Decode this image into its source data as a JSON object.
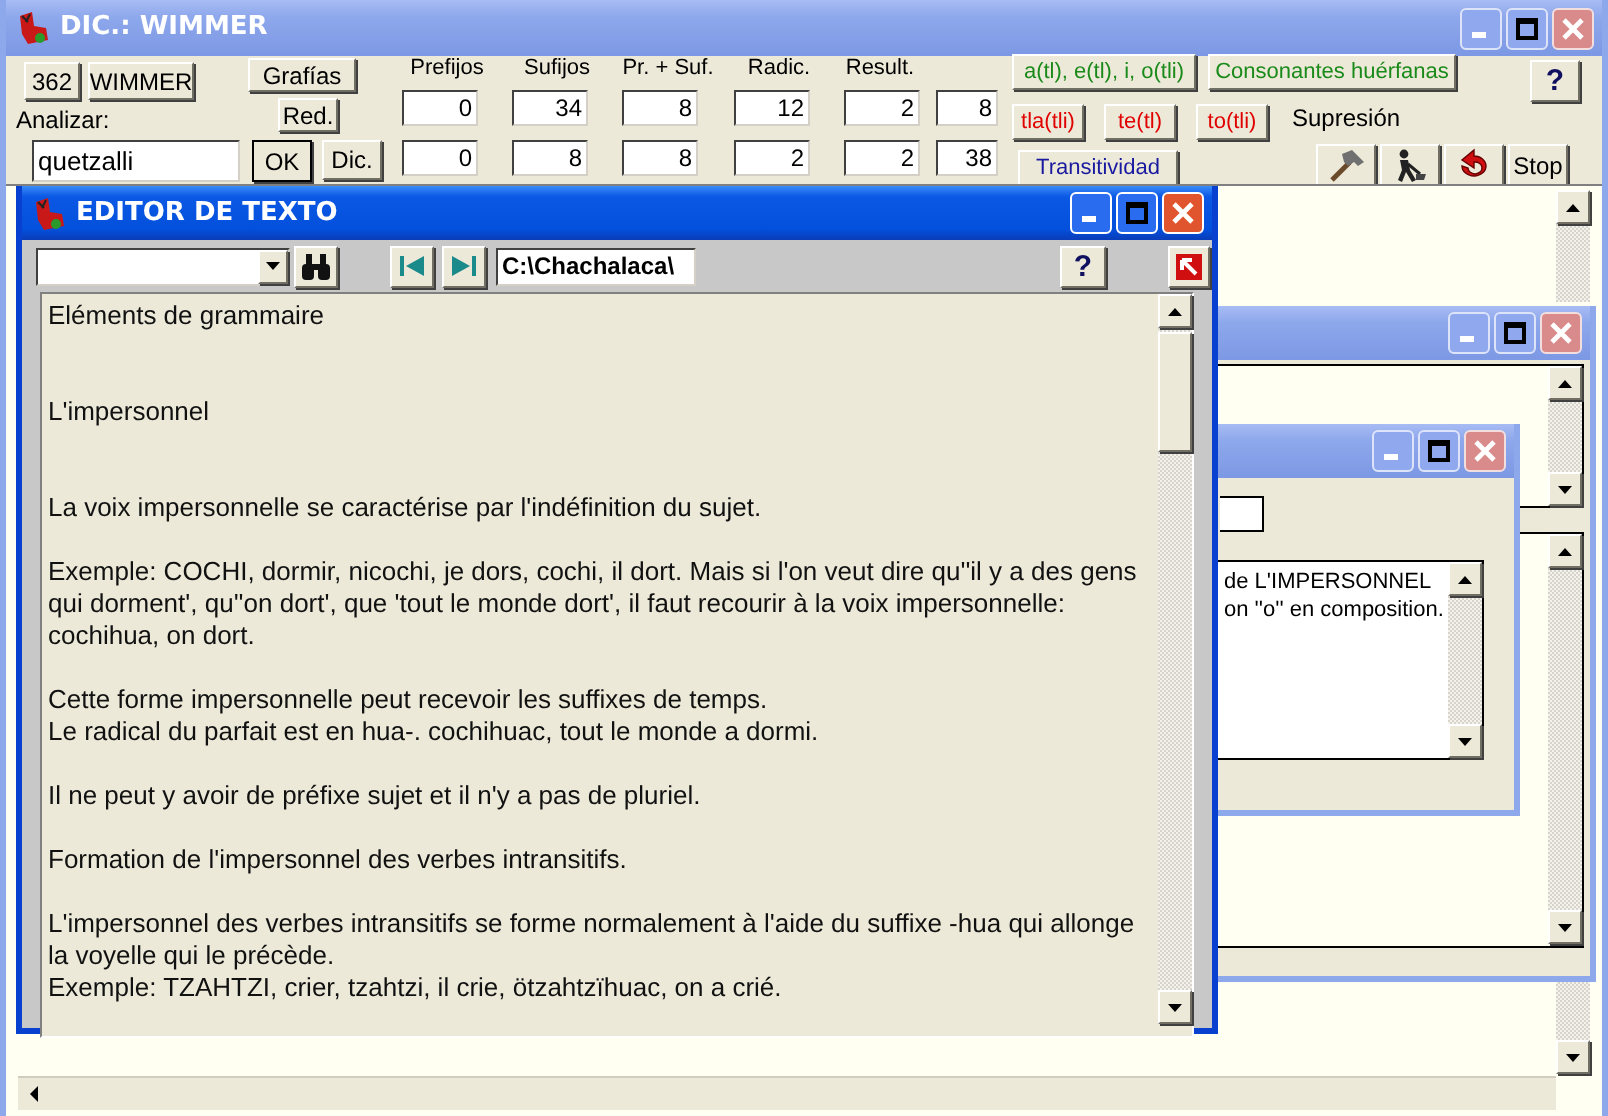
{
  "main_window": {
    "title": "DIC.: WIMMER",
    "active": false,
    "top_buttons": [
      "362",
      "WIMMER"
    ],
    "graphies_button": "Grafías",
    "red_button": "Red.",
    "analyze_label": "Analizar:",
    "analyze_value": "quetzalli",
    "ok_button": "OK",
    "dic_button": "Dic.",
    "counts": {
      "columns": [
        "Prefijos",
        "Sufijos",
        "Pr. + Suf.",
        "Radic.",
        "Result."
      ],
      "rows": [
        [
          "0",
          "34",
          "8",
          "12",
          "2",
          "8"
        ],
        [
          "0",
          "8",
          "8",
          "2",
          "2",
          "38"
        ]
      ]
    },
    "syllable_rows": [
      [
        {
          "label": "a(tl), e(tl), i, o(tli)",
          "color": "#1a8a1a"
        }
      ],
      [
        {
          "label": "tla(tli)",
          "color": "#e00000"
        },
        {
          "label": "te(tl)",
          "color": "#e00000"
        },
        {
          "label": "to(tli)",
          "color": "#e00000"
        }
      ],
      [
        {
          "label": "Transitividad",
          "color": "#1a1aa0"
        }
      ]
    ],
    "orphan_button": {
      "label": "Consonantes huérfanas",
      "color": "#1a8a1a"
    },
    "help_button": "?",
    "suppression_label": "Supresión",
    "tool_buttons": [
      {
        "kind": "hammer"
      },
      {
        "kind": "digger"
      },
      {
        "kind": "undo"
      }
    ],
    "stop_button": "Stop"
  },
  "back_windows": [
    {
      "active": false
    },
    {
      "active": false,
      "lines": [
        "de L'IMPERSONNEL",
        "on ''o'' en composition."
      ]
    }
  ],
  "editor": {
    "title": "EDITOR DE TEXTO",
    "active": true,
    "path": "C:\\Chachalaca\\",
    "help_button": "?",
    "paragraphs": [
      {
        "kind": "heading",
        "lines": [
          "Eléments de grammaire"
        ]
      },
      {
        "kind": "heading",
        "lines": [
          "L'impersonnel"
        ]
      },
      {
        "kind": "text",
        "lines": [
          "La voix impersonnelle se caractérise par l'indéfinition du sujet."
        ]
      },
      {
        "kind": "text",
        "lines": [
          "Exemple: COCHI, dormir, nicochi, je dors, cochi, il dort. Mais si l'on veut dire qu''il y a des gens",
          "qui dorment', qu''on dort', que 'tout le monde dort', il faut recourir à la voix impersonnelle:",
          "cochihua, on dort."
        ]
      },
      {
        "kind": "text",
        "lines": [
          "Cette forme impersonnelle peut recevoir les suffixes de temps.",
          "Le radical du parfait est en hua-. cochihuac, tout le monde a dormi."
        ]
      },
      {
        "kind": "text",
        "lines": [
          "Il ne peut y avoir de préfixe sujet et il n'y a pas de pluriel."
        ]
      },
      {
        "kind": "text",
        "lines": [
          "Formation de l'impersonnel des verbes intransitifs."
        ]
      },
      {
        "kind": "text",
        "lines": [
          "L'impersonnel des verbes intransitifs se forme normalement à l'aide du suffixe -hua qui allonge",
          "la voyelle qui le précède.",
          "Exemple: TZAHTZI, crier, tzahtzi, il crie, ötzahtzïhuac, on a crié."
        ]
      }
    ]
  }
}
